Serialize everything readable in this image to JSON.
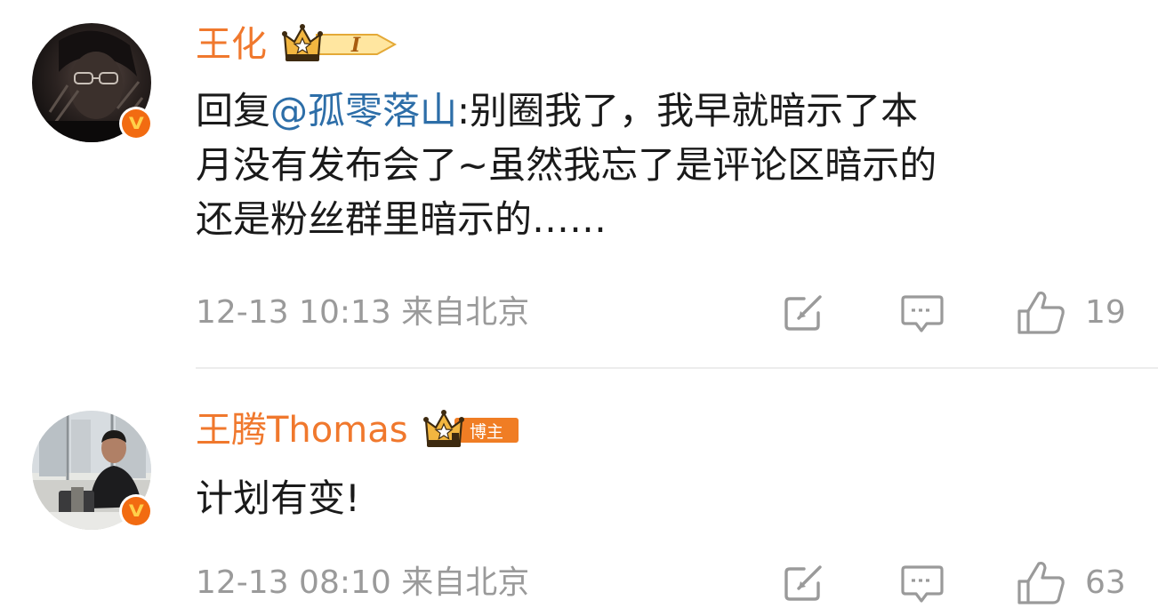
{
  "comments": [
    {
      "username": "王化",
      "badge_text": "I",
      "text_lines": [
        {
          "prefix": "回复",
          "mention": "@孤零落山",
          "rest": ":别圈我了，我早就暗示了本"
        },
        {
          "text": "月没有发布会了~虽然我忘了是评论区暗示的"
        },
        {
          "text": "还是粉丝群里暗示的……"
        }
      ],
      "time": "12-13 10:13",
      "location": "来自北京",
      "likes": "19"
    },
    {
      "username": "王腾Thomas",
      "badge_text": "博主",
      "text": "计划有变!",
      "time": "12-13 08:10",
      "location": "来自北京",
      "likes": "63"
    }
  ],
  "icons": {
    "verified": "verified-v-icon",
    "repost": "repost-icon",
    "reply": "comment-icon",
    "like": "thumbs-up-icon",
    "crown": "crown-icon"
  },
  "colors": {
    "username": "#f0782d",
    "mention": "#2d6ea8",
    "meta": "#9a9a9a",
    "verified": "#f26b11",
    "badge_gold": "#f2b640",
    "badge_orange": "#f07d24"
  }
}
